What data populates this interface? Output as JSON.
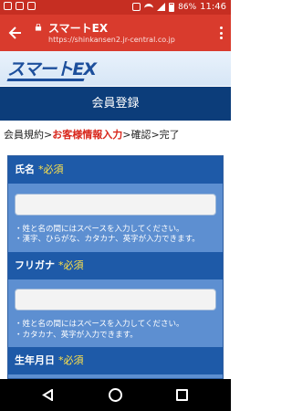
{
  "status_bar": {
    "battery": "86%",
    "time": "11:46"
  },
  "toolbar": {
    "back_icon": "arrow-left-icon",
    "lock_icon": "lock-icon",
    "title": "スマートEX",
    "url": "https://shinkansen2.jr-central.co.jp",
    "menu_icon": "more-vert-icon"
  },
  "logo": {
    "text": "スマートEX"
  },
  "page_title": "会員登録",
  "steps": {
    "step1": "会員規約",
    "sep1": ">",
    "step2": "お客様情報入力",
    "sep2": ">",
    "step3": "確認",
    "sep3": ">",
    "step4": "完了"
  },
  "form": {
    "name": {
      "label": "氏名",
      "required": "*必須",
      "value": "",
      "notes": [
        "・姓と名の間にはスペースを入力してください。",
        "・漢字、ひらがな、カタカナ、英字が入力できます。"
      ]
    },
    "furigana": {
      "label": "フリガナ",
      "required": "*必須",
      "value": "",
      "notes": [
        "・姓と名の間にはスペースを入力してください。",
        "・カタカナ、英字が入力できます。"
      ]
    },
    "birthdate": {
      "label": "生年月日",
      "required": "*必須"
    }
  },
  "colors": {
    "status_bar": "#c62e22",
    "toolbar": "#d93b2d",
    "title_bar": "#0c3d7a",
    "field_header": "#1e5aa8",
    "field_body": "#5d8fd1",
    "required": "#ffe24a",
    "current_step": "#d8261b"
  }
}
